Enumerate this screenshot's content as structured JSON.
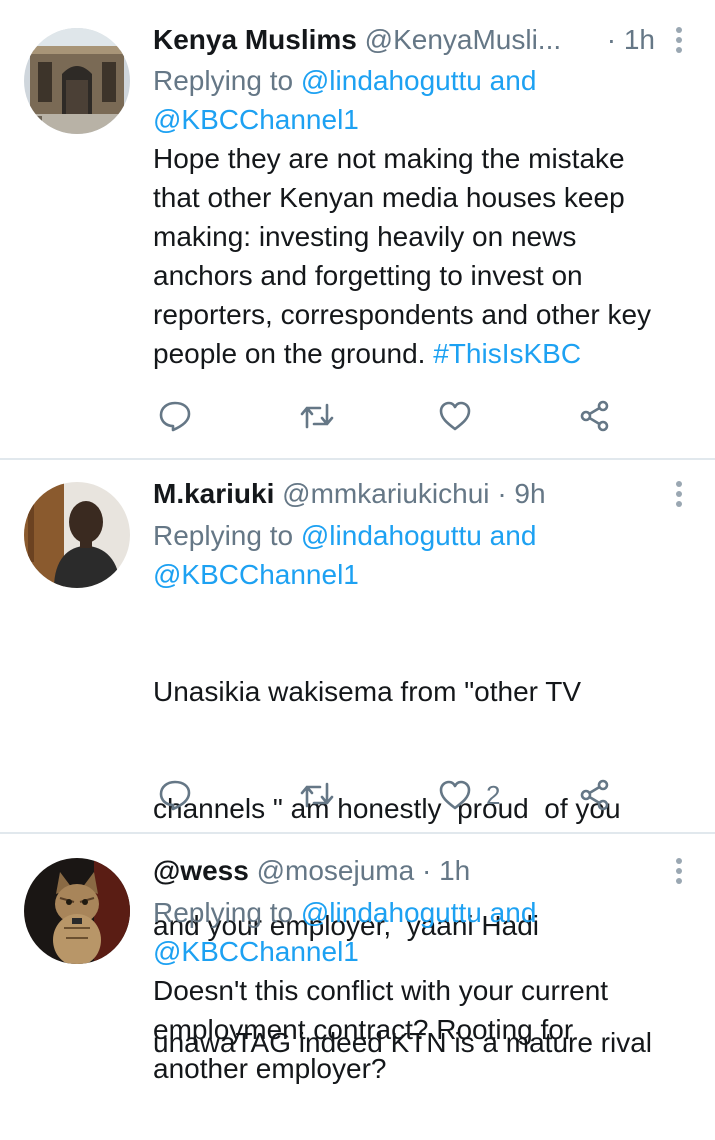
{
  "tweets": [
    {
      "name": "Kenya Muslims",
      "handle": "@KenyaMusli...",
      "time": "· 1h",
      "replying_prefix": "Replying to ",
      "replying_mention": "@lindahoguttu",
      "replying_and": " and",
      "replying_mention2": "@KBCChannel1",
      "text_lines": [
        "Hope they are not making the mistake",
        "that other Kenyan media houses keep",
        "making: investing heavily on news",
        "anchors and forgetting to invest on",
        "reporters, correspondents and other key",
        "people on the ground. "
      ],
      "hashtag": "#ThisIsKBC",
      "like_count": ""
    },
    {
      "name": "M.kariuki",
      "handle": "@mmkariukichui",
      "time": "· 9h",
      "replying_prefix": "Replying to ",
      "replying_mention": "@lindahoguttu",
      "replying_and": " and",
      "replying_mention2": "@KBCChannel1",
      "text_lines": [
        "Unasikia wakisema from \"other TV",
        "channels \" am honestly  proud  of you",
        "and your employer,  yaani Hadi",
        "unawaTAG indeed KTN is a mature rival"
      ],
      "like_count": "2"
    },
    {
      "name": "@wess",
      "handle": "@mosejuma",
      "time": "· 1h",
      "replying_prefix": "Replying to ",
      "replying_mention": "@lindahoguttu",
      "replying_and": " and",
      "replying_mention2": "@KBCChannel1",
      "text_lines": [
        "Doesn't this conflict with your current",
        "employment contract? Rooting for",
        "another employer?"
      ]
    }
  ],
  "icons": {
    "reply": "reply-icon",
    "retweet": "retweet-icon",
    "like": "like-icon",
    "share": "share-icon",
    "more": "more-icon"
  },
  "colors": {
    "link": "#1da1f2",
    "secondary": "#657786",
    "divider": "#e1e8ed"
  }
}
